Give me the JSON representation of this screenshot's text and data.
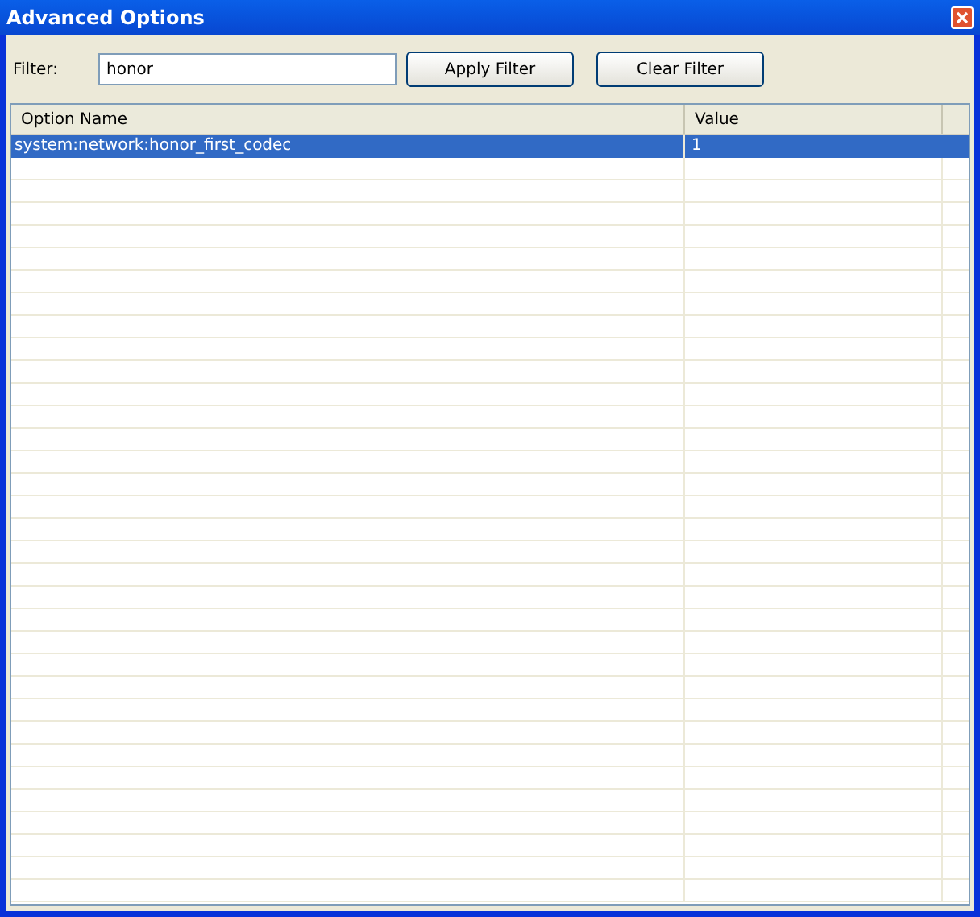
{
  "window": {
    "title": "Advanced Options"
  },
  "filter": {
    "label": "Filter:",
    "value": "honor"
  },
  "buttons": [
    "Apply Filter",
    "Clear Filter"
  ],
  "table": {
    "columns": [
      "Option Name",
      "Value"
    ],
    "rows": [
      {
        "name": "system:network:honor_first_codec",
        "value": "1",
        "selected": true
      }
    ]
  }
}
